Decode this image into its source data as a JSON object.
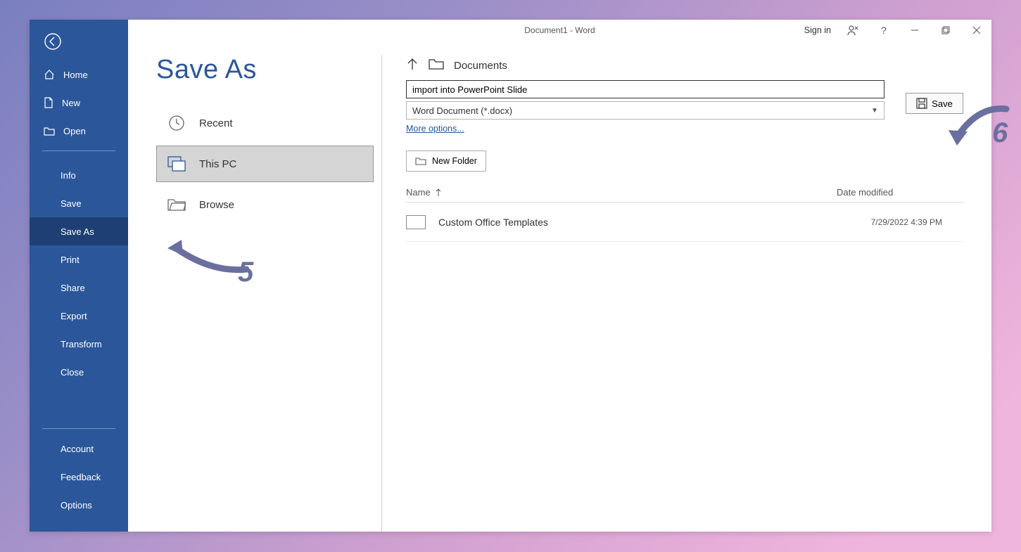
{
  "titlebar": {
    "doc_title": "Document1  -  Word",
    "sign_in": "Sign in"
  },
  "sidebar": {
    "home": "Home",
    "new": "New",
    "open": "Open",
    "info": "Info",
    "save": "Save",
    "save_as": "Save As",
    "print": "Print",
    "share": "Share",
    "export": "Export",
    "transform": "Transform",
    "close": "Close",
    "account": "Account",
    "feedback": "Feedback",
    "options": "Options"
  },
  "page": {
    "title": "Save As"
  },
  "locations": {
    "recent": "Recent",
    "this_pc": "This PC",
    "browse": "Browse"
  },
  "breadcrumb": {
    "folder": "Documents"
  },
  "file": {
    "name_value": "import into PowerPoint Slide",
    "type_label": "Word Document (*.docx)",
    "more_options": "More options...",
    "save_label": "Save",
    "new_folder": "New Folder"
  },
  "list": {
    "col_name": "Name",
    "col_date": "Date modified",
    "items": [
      {
        "name": "Custom Office Templates",
        "date": "7/29/2022 4:39 PM"
      }
    ]
  },
  "annotations": {
    "five": "5",
    "six": "6"
  }
}
